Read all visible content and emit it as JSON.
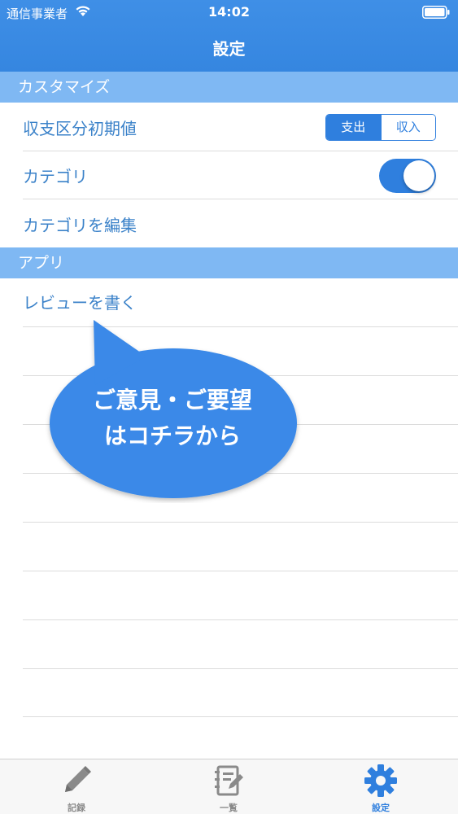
{
  "status_bar": {
    "carrier": "通信事業者",
    "time": "14:02"
  },
  "nav": {
    "title": "設定"
  },
  "sections": [
    {
      "title": "カスタマイズ"
    },
    {
      "title": "アプリ"
    }
  ],
  "rows": {
    "default_type": {
      "label": "収支区分初期値",
      "options": [
        "支出",
        "収入"
      ],
      "selected": "支出"
    },
    "category": {
      "label": "カテゴリ",
      "toggle_on": true
    },
    "edit_category": {
      "label": "カテゴリを編集"
    },
    "review": {
      "label": "レビューを書く"
    }
  },
  "bubble": {
    "line1": "ご意見・ご要望",
    "line2": "はコチラから"
  },
  "tabbar": {
    "items": [
      {
        "label": "記録",
        "icon": "pencil-icon"
      },
      {
        "label": "一覧",
        "icon": "list-icon"
      },
      {
        "label": "設定",
        "icon": "gear-icon"
      }
    ],
    "selected": "設定"
  },
  "colors": {
    "accent": "#2f7fde",
    "header": "#3a8ae3",
    "section": "#7fb8f3",
    "label": "#3b82c9"
  }
}
